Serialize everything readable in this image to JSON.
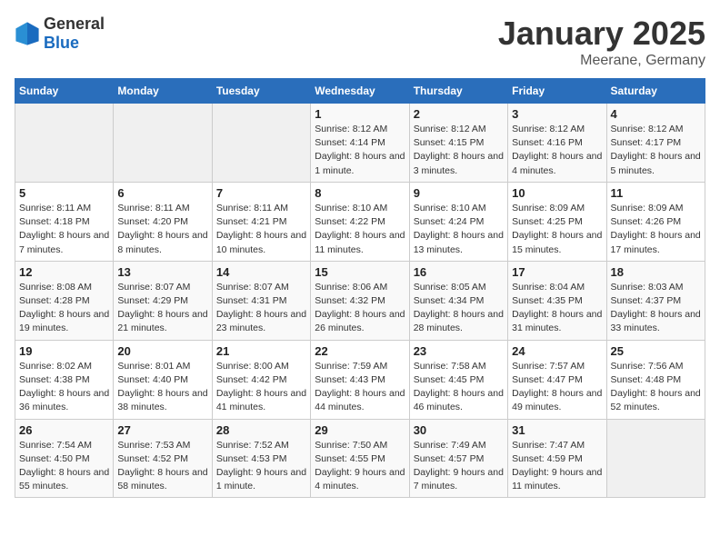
{
  "header": {
    "logo_general": "General",
    "logo_blue": "Blue",
    "title": "January 2025",
    "subtitle": "Meerane, Germany"
  },
  "weekdays": [
    "Sunday",
    "Monday",
    "Tuesday",
    "Wednesday",
    "Thursday",
    "Friday",
    "Saturday"
  ],
  "weeks": [
    [
      {
        "day": "",
        "empty": true
      },
      {
        "day": "",
        "empty": true
      },
      {
        "day": "",
        "empty": true
      },
      {
        "day": "1",
        "sunrise": "8:12 AM",
        "sunset": "4:14 PM",
        "daylight": "8 hours and 1 minute."
      },
      {
        "day": "2",
        "sunrise": "8:12 AM",
        "sunset": "4:15 PM",
        "daylight": "8 hours and 3 minutes."
      },
      {
        "day": "3",
        "sunrise": "8:12 AM",
        "sunset": "4:16 PM",
        "daylight": "8 hours and 4 minutes."
      },
      {
        "day": "4",
        "sunrise": "8:12 AM",
        "sunset": "4:17 PM",
        "daylight": "8 hours and 5 minutes."
      }
    ],
    [
      {
        "day": "5",
        "sunrise": "8:11 AM",
        "sunset": "4:18 PM",
        "daylight": "8 hours and 7 minutes."
      },
      {
        "day": "6",
        "sunrise": "8:11 AM",
        "sunset": "4:20 PM",
        "daylight": "8 hours and 8 minutes."
      },
      {
        "day": "7",
        "sunrise": "8:11 AM",
        "sunset": "4:21 PM",
        "daylight": "8 hours and 10 minutes."
      },
      {
        "day": "8",
        "sunrise": "8:10 AM",
        "sunset": "4:22 PM",
        "daylight": "8 hours and 11 minutes."
      },
      {
        "day": "9",
        "sunrise": "8:10 AM",
        "sunset": "4:24 PM",
        "daylight": "8 hours and 13 minutes."
      },
      {
        "day": "10",
        "sunrise": "8:09 AM",
        "sunset": "4:25 PM",
        "daylight": "8 hours and 15 minutes."
      },
      {
        "day": "11",
        "sunrise": "8:09 AM",
        "sunset": "4:26 PM",
        "daylight": "8 hours and 17 minutes."
      }
    ],
    [
      {
        "day": "12",
        "sunrise": "8:08 AM",
        "sunset": "4:28 PM",
        "daylight": "8 hours and 19 minutes."
      },
      {
        "day": "13",
        "sunrise": "8:07 AM",
        "sunset": "4:29 PM",
        "daylight": "8 hours and 21 minutes."
      },
      {
        "day": "14",
        "sunrise": "8:07 AM",
        "sunset": "4:31 PM",
        "daylight": "8 hours and 23 minutes."
      },
      {
        "day": "15",
        "sunrise": "8:06 AM",
        "sunset": "4:32 PM",
        "daylight": "8 hours and 26 minutes."
      },
      {
        "day": "16",
        "sunrise": "8:05 AM",
        "sunset": "4:34 PM",
        "daylight": "8 hours and 28 minutes."
      },
      {
        "day": "17",
        "sunrise": "8:04 AM",
        "sunset": "4:35 PM",
        "daylight": "8 hours and 31 minutes."
      },
      {
        "day": "18",
        "sunrise": "8:03 AM",
        "sunset": "4:37 PM",
        "daylight": "8 hours and 33 minutes."
      }
    ],
    [
      {
        "day": "19",
        "sunrise": "8:02 AM",
        "sunset": "4:38 PM",
        "daylight": "8 hours and 36 minutes."
      },
      {
        "day": "20",
        "sunrise": "8:01 AM",
        "sunset": "4:40 PM",
        "daylight": "8 hours and 38 minutes."
      },
      {
        "day": "21",
        "sunrise": "8:00 AM",
        "sunset": "4:42 PM",
        "daylight": "8 hours and 41 minutes."
      },
      {
        "day": "22",
        "sunrise": "7:59 AM",
        "sunset": "4:43 PM",
        "daylight": "8 hours and 44 minutes."
      },
      {
        "day": "23",
        "sunrise": "7:58 AM",
        "sunset": "4:45 PM",
        "daylight": "8 hours and 46 minutes."
      },
      {
        "day": "24",
        "sunrise": "7:57 AM",
        "sunset": "4:47 PM",
        "daylight": "8 hours and 49 minutes."
      },
      {
        "day": "25",
        "sunrise": "7:56 AM",
        "sunset": "4:48 PM",
        "daylight": "8 hours and 52 minutes."
      }
    ],
    [
      {
        "day": "26",
        "sunrise": "7:54 AM",
        "sunset": "4:50 PM",
        "daylight": "8 hours and 55 minutes."
      },
      {
        "day": "27",
        "sunrise": "7:53 AM",
        "sunset": "4:52 PM",
        "daylight": "8 hours and 58 minutes."
      },
      {
        "day": "28",
        "sunrise": "7:52 AM",
        "sunset": "4:53 PM",
        "daylight": "9 hours and 1 minute."
      },
      {
        "day": "29",
        "sunrise": "7:50 AM",
        "sunset": "4:55 PM",
        "daylight": "9 hours and 4 minutes."
      },
      {
        "day": "30",
        "sunrise": "7:49 AM",
        "sunset": "4:57 PM",
        "daylight": "9 hours and 7 minutes."
      },
      {
        "day": "31",
        "sunrise": "7:47 AM",
        "sunset": "4:59 PM",
        "daylight": "9 hours and 11 minutes."
      },
      {
        "day": "",
        "empty": true
      }
    ]
  ]
}
